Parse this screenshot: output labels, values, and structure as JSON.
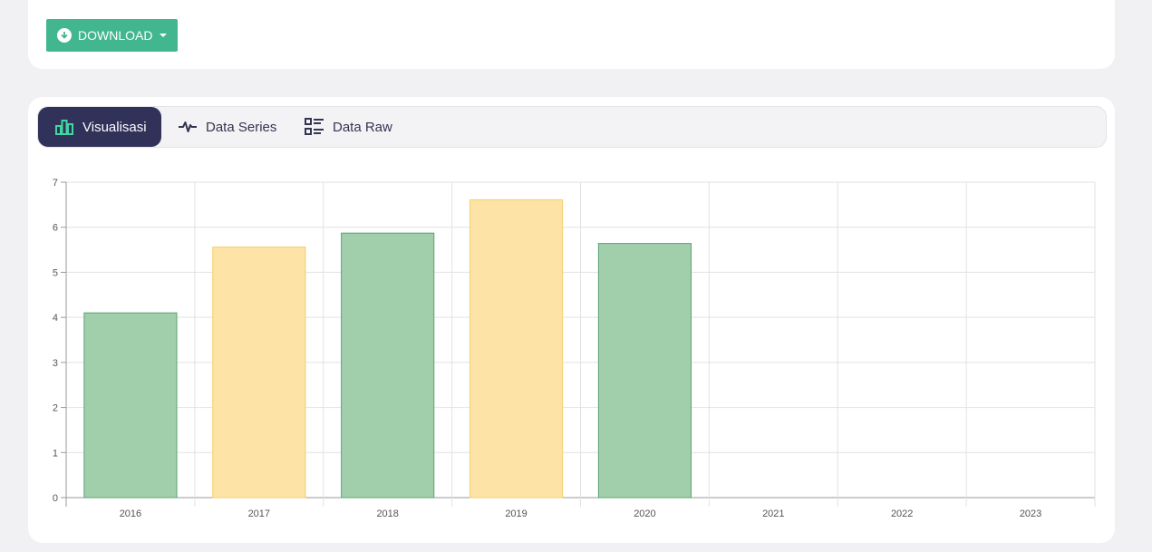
{
  "toolbar": {
    "download_label": "DOWNLOAD"
  },
  "tabs": [
    {
      "label": "Visualisasi",
      "active": true,
      "icon": "bar-chart-icon"
    },
    {
      "label": "Data Series",
      "active": false,
      "icon": "pulse-icon"
    },
    {
      "label": "Data Raw",
      "active": false,
      "icon": "list-icon"
    }
  ],
  "colors": {
    "accent": "#42b68f",
    "tab_active": "#30325a",
    "green_fill": "#a1cfab",
    "green_border": "#5aa371",
    "yellow_fill": "#fde3a6",
    "yellow_border": "#f3cf6c"
  },
  "chart_data": {
    "type": "bar",
    "categories": [
      "2016",
      "2017",
      "2018",
      "2019",
      "2020",
      "2021",
      "2022",
      "2023"
    ],
    "values": [
      4.1,
      5.56,
      5.87,
      6.61,
      5.64,
      null,
      null,
      null
    ],
    "bar_colors": [
      "green",
      "yellow",
      "green",
      "yellow",
      "green",
      "green",
      "green",
      "green"
    ],
    "ylim": [
      0,
      7
    ],
    "yticks": [
      0,
      1,
      2,
      3,
      4,
      5,
      6,
      7
    ],
    "grid": true,
    "title": "",
    "xlabel": "",
    "ylabel": ""
  }
}
